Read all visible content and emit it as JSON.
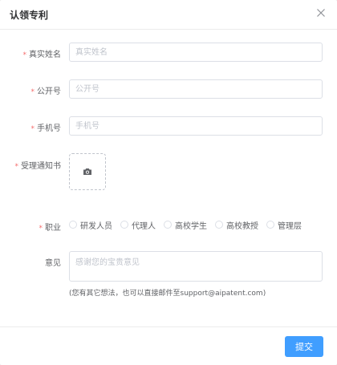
{
  "dialog": {
    "title": "认领专利"
  },
  "form": {
    "required_mark": "*",
    "real_name": {
      "label": "真实姓名",
      "placeholder": "真实姓名"
    },
    "publication_no": {
      "label": "公开号",
      "placeholder": "公开号"
    },
    "phone": {
      "label": "手机号",
      "placeholder": "手机号"
    },
    "notice": {
      "label": "受理通知书"
    },
    "occupation": {
      "label": "职业",
      "options": [
        {
          "label": "研发人员"
        },
        {
          "label": "代理人"
        },
        {
          "label": "高校学生"
        },
        {
          "label": "高校教授"
        },
        {
          "label": "管理层"
        }
      ]
    },
    "feedback": {
      "label": "意见",
      "placeholder": "感谢您的宝贵意见",
      "hint": "(您有其它想法，也可以直接邮件至support@aipatent.com)"
    }
  },
  "footer": {
    "submit_label": "提交"
  },
  "colors": {
    "primary": "#409eff",
    "required": "#f56c6c",
    "border": "#dcdfe6"
  },
  "icons": {
    "close": "close-icon",
    "upload": "camera-icon"
  }
}
